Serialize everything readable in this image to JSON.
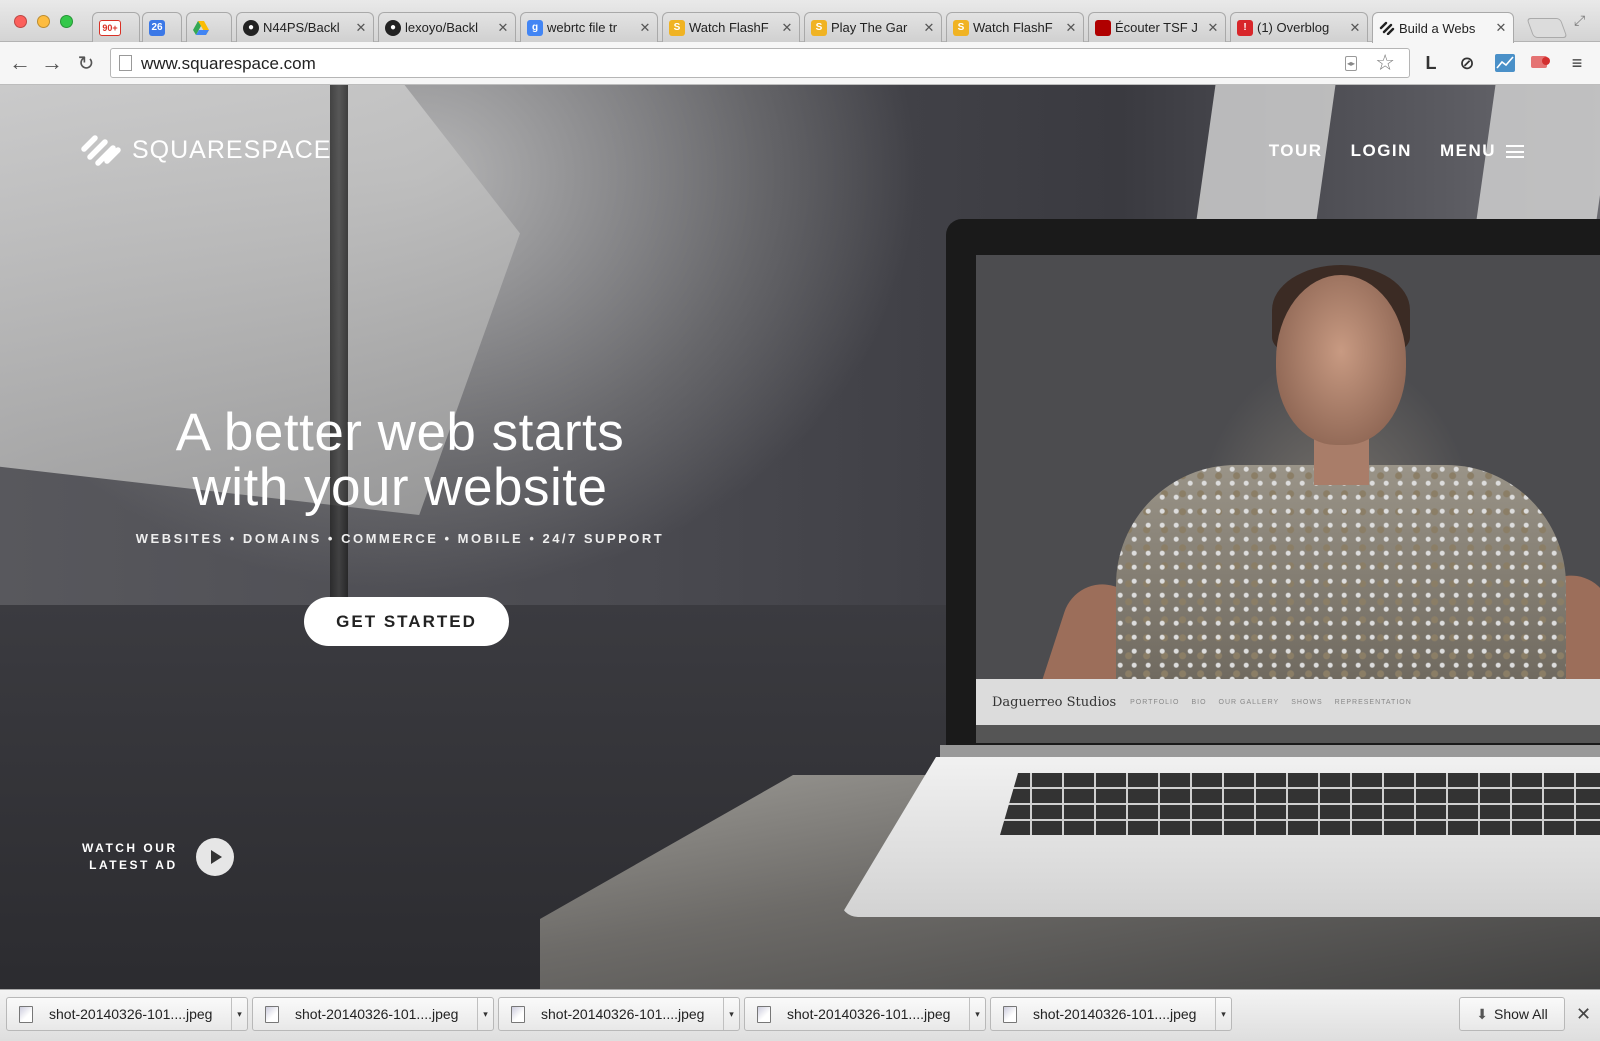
{
  "browser": {
    "tabs": [
      {
        "label": "",
        "favicon": "gmail-icon",
        "badge": "90+",
        "color": "#d93025"
      },
      {
        "label": "",
        "favicon": "calendar-icon",
        "badge": "26",
        "color": "#3b78e7"
      },
      {
        "label": "",
        "favicon": "drive-icon",
        "badge": "",
        "color": "#34a853"
      },
      {
        "label": "N44PS/Backl",
        "favicon": "github-icon",
        "color": "#222222"
      },
      {
        "label": "lexoyo/Backl",
        "favicon": "github-icon",
        "color": "#222222"
      },
      {
        "label": "webrtc file tr",
        "favicon": "google-search-icon",
        "color": "#4285f4"
      },
      {
        "label": "Watch FlashF",
        "favicon": "watch-flash-icon",
        "color": "#f0b323"
      },
      {
        "label": "Play The Gar",
        "favicon": "watch-flash-icon",
        "color": "#f0b323"
      },
      {
        "label": "Watch FlashF",
        "favicon": "watch-flash-icon",
        "color": "#f0b323"
      },
      {
        "label": "Écouter TSF J",
        "favicon": "tsf-jazz-icon",
        "color": "#b00000"
      },
      {
        "label": "(1) Overblog",
        "favicon": "overblog-icon",
        "color": "#d8262a"
      },
      {
        "label": "Build a Webs",
        "favicon": "squarespace-icon",
        "color": "#222222"
      }
    ],
    "url": "www.squarespace.com",
    "extensions": {
      "lastpass": "L"
    }
  },
  "site": {
    "logo_text": "SQUARESPACE",
    "nav": {
      "tour": "TOUR",
      "login": "LOGIN",
      "menu": "MENU"
    },
    "hero": {
      "title_line1": "A better web starts",
      "title_line2": "with your website",
      "subtitle": "WEBSITES • DOMAINS • COMMERCE • MOBILE • 24/7 SUPPORT",
      "cta": "GET STARTED"
    },
    "watch": {
      "line1": "WATCH OUR",
      "line2": "LATEST AD"
    },
    "laptop_screen": {
      "brand": "Daguerreo Studios",
      "links": [
        "PORTFOLIO",
        "BIO",
        "OUR GALLERY",
        "SHOWS",
        "REPRESENTATION"
      ]
    }
  },
  "downloads": {
    "items": [
      "shot-20140326-101....jpeg",
      "shot-20140326-101....jpeg",
      "shot-20140326-101....jpeg",
      "shot-20140326-101....jpeg",
      "shot-20140326-101....jpeg"
    ],
    "show_all": "Show All"
  }
}
